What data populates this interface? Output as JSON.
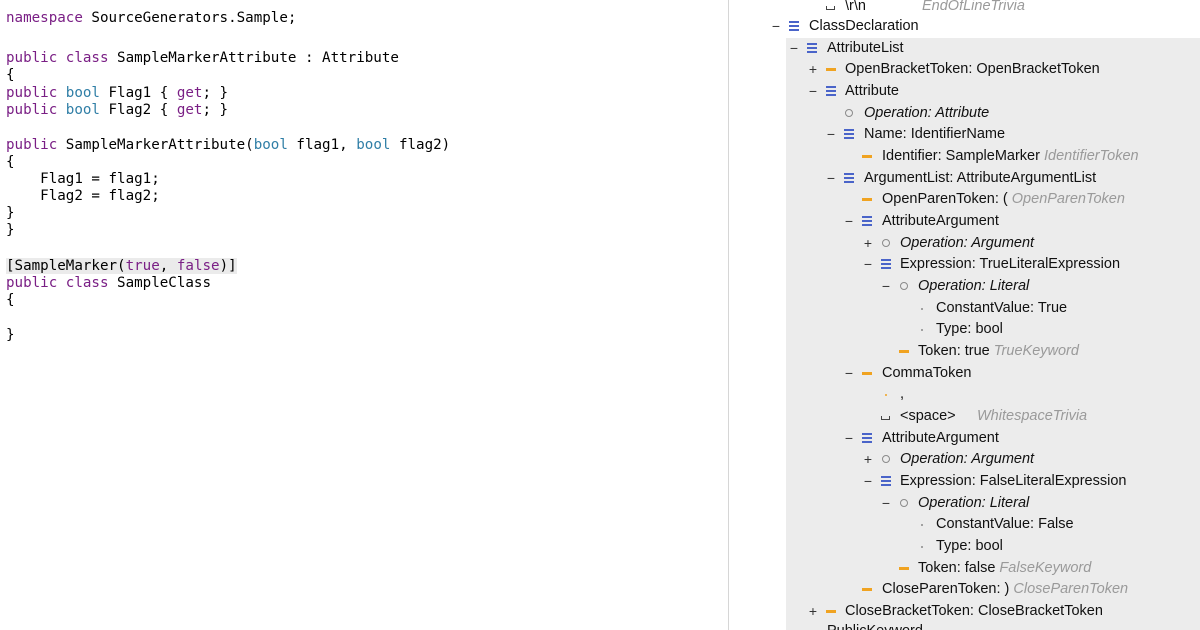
{
  "code": {
    "namespace_kw": "namespace",
    "namespace_rest": " SourceGenerators.Sample;",
    "line2_kw": "public class",
    "line2_rest": " SampleMarkerAttribute : Attribute",
    "open_brace": "{",
    "close_brace": "}",
    "kw_public": "public",
    "kw_bool": "bool",
    "flag1_name": " Flag1 { ",
    "kw_get": "get",
    "prop_end": "; }",
    "flag2_name": " Flag2 { ",
    "ctor_name": " SampleMarkerAttribute(",
    "ctor_p1": " flag1, ",
    "ctor_p2": " flag2)",
    "assign1": "    Flag1 = flag1;",
    "assign2": "    Flag2 = flag2;",
    "attr_open": "[SampleMarker(",
    "kw_true": "true",
    "attr_comma": ", ",
    "kw_false": "false",
    "attr_close": ")]",
    "class2_kw": "public class",
    "class2_rest": " SampleClass"
  },
  "tree": {
    "n0": {
      "label": "\\r\\n",
      "kind": "EndOfLineTrivia"
    },
    "n1": {
      "toggle": "−",
      "label": "ClassDeclaration"
    },
    "n2": {
      "toggle": "−",
      "label": "AttributeList"
    },
    "n3": {
      "toggle": "+",
      "label": "OpenBracketToken: OpenBracketToken"
    },
    "n4": {
      "toggle": "−",
      "label": "Attribute"
    },
    "n5": {
      "label": "Operation: Attribute"
    },
    "n6": {
      "toggle": "−",
      "label": "Name: IdentifierName"
    },
    "n7": {
      "label": "Identifier: SampleMarker",
      "kind": "IdentifierToken"
    },
    "n8": {
      "toggle": "−",
      "label": "ArgumentList: AttributeArgumentList"
    },
    "n9": {
      "label": "OpenParenToken: (",
      "kind": "OpenParenToken"
    },
    "n10": {
      "toggle": "−",
      "label": "AttributeArgument"
    },
    "n11": {
      "toggle": "+",
      "label": "Operation: Argument"
    },
    "n12": {
      "toggle": "−",
      "label": "Expression: TrueLiteralExpression"
    },
    "n13": {
      "toggle": "−",
      "label": "Operation: Literal"
    },
    "n14": {
      "label": "ConstantValue: True"
    },
    "n15": {
      "label": "Type: bool"
    },
    "n16": {
      "label": "Token: true",
      "kind": "TrueKeyword"
    },
    "n17": {
      "toggle": "−",
      "label": "CommaToken"
    },
    "n18": {
      "label": ","
    },
    "n19": {
      "label": "<space>",
      "kind": "WhitespaceTrivia"
    },
    "n20": {
      "toggle": "−",
      "label": "AttributeArgument"
    },
    "n21": {
      "toggle": "+",
      "label": "Operation: Argument"
    },
    "n22": {
      "toggle": "−",
      "label": "Expression: FalseLiteralExpression"
    },
    "n23": {
      "toggle": "−",
      "label": "Operation: Literal"
    },
    "n24": {
      "label": "ConstantValue: False"
    },
    "n25": {
      "label": "Type: bool"
    },
    "n26": {
      "label": "Token: false",
      "kind": "FalseKeyword"
    },
    "n27": {
      "label": "CloseParenToken: )",
      "kind": "CloseParenToken"
    },
    "n28": {
      "toggle": "+",
      "label": "CloseBracketToken: CloseBracketToken"
    },
    "n29": {
      "label": "PublicKeyword"
    }
  },
  "colors": {
    "keyword_purple": "#7a1f85",
    "keyword_blue": "#2f7ea6",
    "list_icon": "#4a64c9",
    "token_icon": "#f0a321",
    "selection_bg": "#ececec"
  }
}
